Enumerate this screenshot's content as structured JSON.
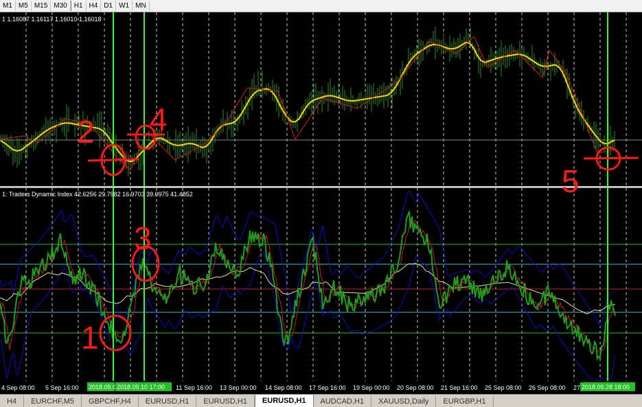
{
  "toolbar": {
    "timeframes": [
      "M1",
      "M5",
      "M15",
      "M30",
      "H1",
      "H4",
      "D1",
      "W1",
      "MN"
    ]
  },
  "price_pane": {
    "header": "1  1.16087 1.16117 1.16010 1.16018"
  },
  "indicator_pane": {
    "header": "1: Traders Dynamic Index 42.6256 29.7982 16.9703 39.0975 41.4852"
  },
  "time_axis": {
    "labels": [
      "4 Sep 08:00",
      "5 Sep 16:00",
      "11 Sep 16:00",
      "13 Sep 00:00",
      "14 Sep 08:00",
      "17 Sep 16:00",
      "19 Sep 00:00",
      "20 Sep 08:00",
      "21 Sep 16:00",
      "25 Sep 08:00",
      "26 Sep 08:00",
      "27"
    ],
    "highlight_labels": [
      "2018.09.0",
      "2018.09.10 17:00",
      "2018.09.28 18:00"
    ]
  },
  "annotations": {
    "labels": [
      "2",
      "4",
      "3",
      "1",
      "5"
    ]
  },
  "tabs": [
    {
      "label": "H4",
      "active": false
    },
    {
      "label": "EURCHF,M5",
      "active": false
    },
    {
      "label": "GBPCHF,H4",
      "active": false
    },
    {
      "label": "EURUSD,H1",
      "active": false
    },
    {
      "label": "EURUSD,H1",
      "active": false
    },
    {
      "label": "EURUSD,H1",
      "active": true
    },
    {
      "label": "AUDCAD,H1",
      "active": false
    },
    {
      "label": "XAUUSD,Daily",
      "active": false
    },
    {
      "label": "EURGBP,H1",
      "active": false
    }
  ],
  "colors": {
    "background": "#000000",
    "candles": "#2e8b2e",
    "ma": "#ffd700",
    "zigzag": "#d02020",
    "tdi_green": "#1f9e1f",
    "tdi_red": "#c02020",
    "tdi_yellow": "#e8e890",
    "band": "#1010c0",
    "vline": "#33ff33",
    "annotation": "#ff1a1a"
  }
}
